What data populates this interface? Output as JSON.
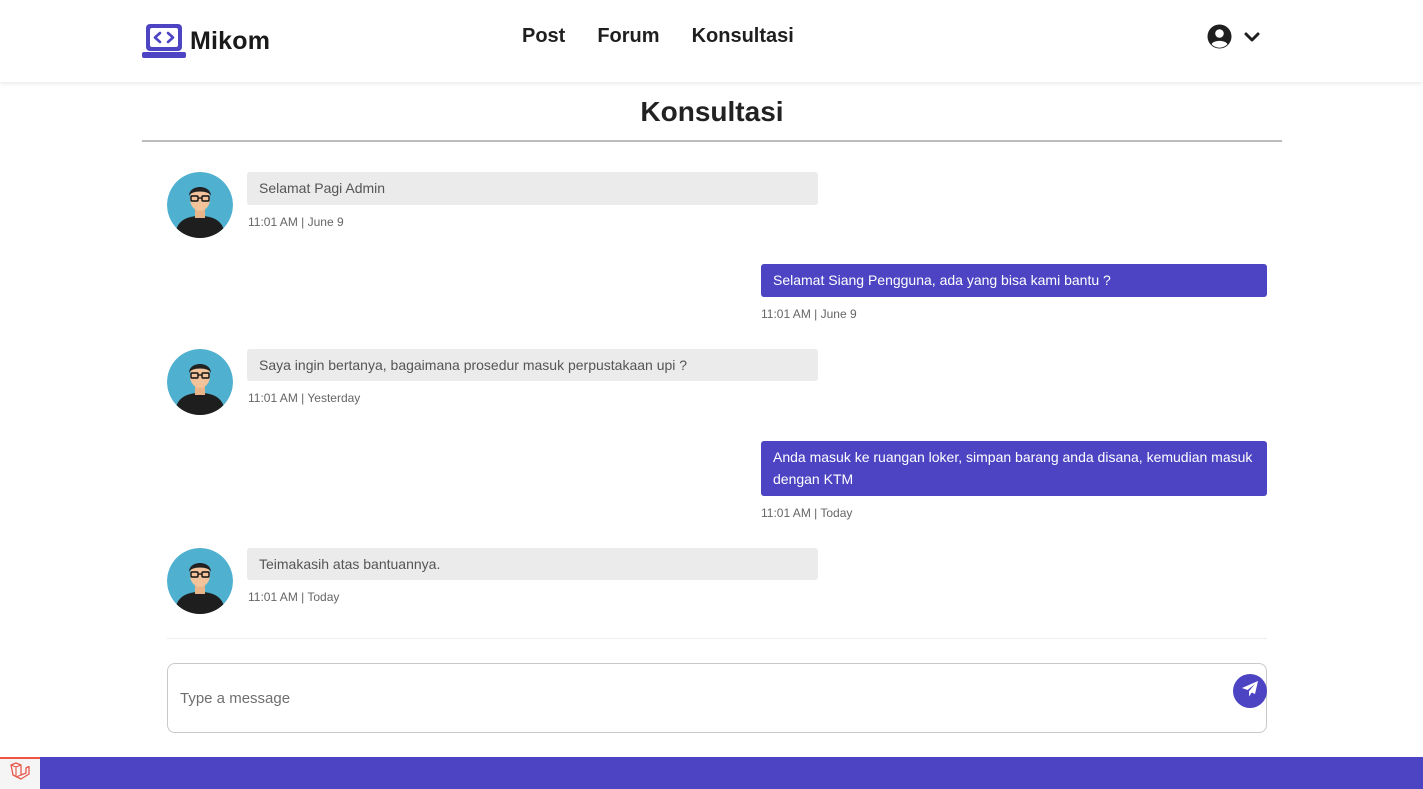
{
  "header": {
    "brand_name": "Mikom",
    "nav": [
      "Post",
      "Forum",
      "Konsultasi"
    ],
    "user_icon": "user-circle-icon",
    "dropdown_icon": "chevron-down-icon"
  },
  "page": {
    "title": "Konsultasi"
  },
  "messages": [
    {
      "direction": "incoming",
      "text": "Selamat Pagi Admin",
      "meta": "11:01 AM | June 9"
    },
    {
      "direction": "outgoing",
      "text": "Selamat Siang Pengguna, ada yang bisa kami bantu ?",
      "meta": "11:01 AM | June 9"
    },
    {
      "direction": "incoming",
      "text": "Saya ingin bertanya, bagaimana prosedur masuk perpustakaan upi ?",
      "meta": "11:01 AM | Yesterday"
    },
    {
      "direction": "outgoing",
      "text": "Anda masuk ke ruangan loker, simpan barang anda disana, kemudian masuk dengan KTM",
      "meta": "11:01 AM | Today"
    },
    {
      "direction": "incoming",
      "text": "Teimakasih atas bantuannya.",
      "meta": "11:01 AM | Today"
    }
  ],
  "composer": {
    "placeholder": "Type a message",
    "send_icon": "paper-plane-icon"
  },
  "colors": {
    "accent": "#4c44c3",
    "incoming_bubble": "#ebebeb",
    "avatar_bg": "#4fb0cf"
  }
}
